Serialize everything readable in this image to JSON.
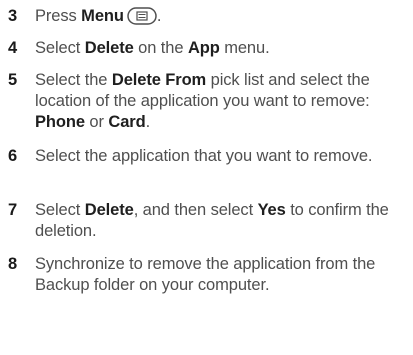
{
  "steps": [
    {
      "number": "3",
      "parts": [
        "Press ",
        "Menu",
        "."
      ]
    },
    {
      "number": "4",
      "parts": [
        "Select ",
        "Delete",
        " on the ",
        "App",
        " menu."
      ]
    },
    {
      "number": "5",
      "parts": [
        "Select the ",
        "Delete From",
        " pick list and select the location of the application you want to remove: ",
        "Phone",
        " or ",
        "Card",
        "."
      ]
    },
    {
      "number": "6",
      "parts": [
        "Select the application that you want to remove."
      ]
    },
    {
      "number": "7",
      "parts": [
        "Select ",
        "Delete",
        ", and then select ",
        "Yes",
        " to confirm the deletion."
      ]
    },
    {
      "number": "8",
      "parts": [
        "Synchronize to remove the application from the Backup folder on your computer."
      ]
    }
  ],
  "icons": {
    "menu_key": "menu-key-icon"
  }
}
